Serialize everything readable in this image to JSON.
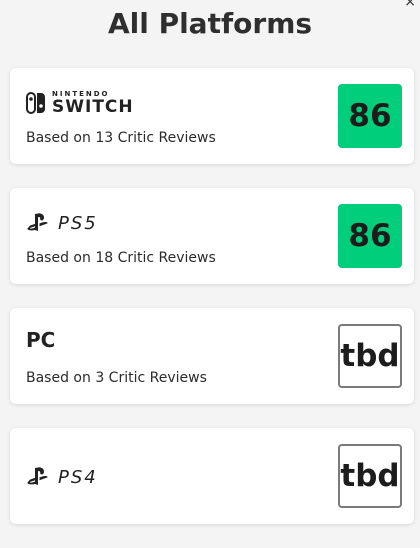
{
  "header": {
    "title": "All Platforms",
    "corner_mark": "×"
  },
  "platforms": [
    {
      "logo": "nintendo-switch-logo",
      "logo_small_text": "NINTENDO",
      "logo_large_text": "SWITCH",
      "reviews_text": "Based on 13 Critic Reviews",
      "score": "86",
      "score_color": "#00ce7a"
    },
    {
      "logo": "ps5-logo",
      "logo_text": "PS5",
      "reviews_text": "Based on 18 Critic Reviews",
      "score": "86",
      "score_color": "#00ce7a"
    },
    {
      "name": "PC",
      "reviews_text": "Based on 3 Critic Reviews",
      "score": "tbd"
    },
    {
      "logo": "ps4-logo",
      "logo_text": "PS4",
      "score": "tbd"
    }
  ]
}
